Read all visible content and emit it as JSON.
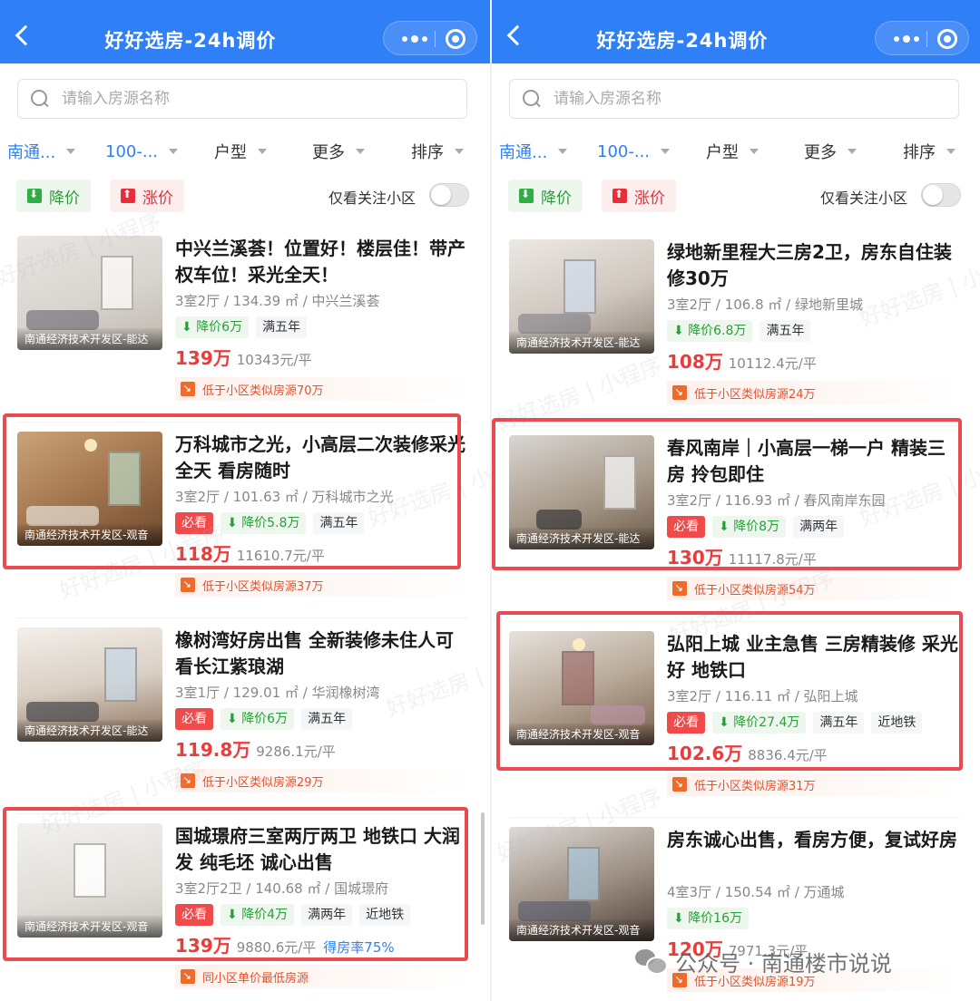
{
  "panels": [
    {
      "nav_title": "好好选房-24h调价",
      "search_placeholder": "请输入房源名称",
      "filters": [
        "南通...",
        "100-...",
        "户型",
        "更多",
        "排序"
      ],
      "price_down_chip": "降价",
      "price_up_chip": "涨价",
      "follow_label": "仅看关注小区",
      "cards": [
        {
          "title": "中兴兰溪荟！位置好！楼层佳！带产权车位！采光全天！",
          "meta": "3室2厅 / 134.39 ㎡ / 中兴兰溪荟",
          "image_caption": "南通经济技术开发区-能达",
          "must_tag": "",
          "drop_tag": "降价6万",
          "tags": [
            "满五年"
          ],
          "price": "139万",
          "unit_price": "10343元/平",
          "extra": "",
          "hint": "低于小区类似房源70万"
        },
        {
          "title": "万科城市之光，小高层二次装修采光全天 看房随时",
          "meta": "3室2厅 / 101.63 ㎡ / 万科城市之光",
          "image_caption": "南通经济技术开发区-观音",
          "must_tag": "必看",
          "drop_tag": "降价5.8万",
          "tags": [
            "满五年"
          ],
          "price": "118万",
          "unit_price": "11610.7元/平",
          "extra": "",
          "hint": "低于小区类似房源37万"
        },
        {
          "title": "橡树湾好房出售 全新装修未住人可看长江紫琅湖",
          "meta": "3室1厅 / 129.01 ㎡ / 华润橡树湾",
          "image_caption": "南通经济技术开发区-能达",
          "must_tag": "必看",
          "drop_tag": "降价6万",
          "tags": [
            "满五年"
          ],
          "price": "119.8万",
          "unit_price": "9286.1元/平",
          "extra": "",
          "hint": "低于小区类似房源29万"
        },
        {
          "title": "国城璟府三室两厅两卫 地铁口 大润发 纯毛坯 诚心出售",
          "meta": "3室2厅2卫 / 140.68 ㎡ / 国城璟府",
          "image_caption": "南通经济技术开发区-观音",
          "must_tag": "必看",
          "drop_tag": "降价4万",
          "tags": [
            "满两年",
            "近地铁"
          ],
          "price": "139万",
          "unit_price": "9880.6元/平",
          "extra": "得房率75%",
          "hint": "同小区单价最低房源"
        }
      ]
    },
    {
      "nav_title": "好好选房-24h调价",
      "search_placeholder": "请输入房源名称",
      "filters": [
        "南通...",
        "100-...",
        "户型",
        "更多",
        "排序"
      ],
      "price_down_chip": "降价",
      "price_up_chip": "涨价",
      "follow_label": "仅看关注小区",
      "cards": [
        {
          "title": "绿地新里程大三房2卫，房东自住装修30万",
          "meta": "3室2厅 / 106.8 ㎡ / 绿地新里城",
          "image_caption": "南通经济技术开发区-能达",
          "must_tag": "",
          "drop_tag": "降价6.8万",
          "tags": [
            "满五年"
          ],
          "price": "108万",
          "unit_price": "10112.4元/平",
          "extra": "",
          "hint": "低于小区类似房源24万"
        },
        {
          "title": "春风南岸｜小高层一梯一户 精装三房 拎包即住",
          "meta": "3室2厅 / 116.93 ㎡ / 春风南岸东园",
          "image_caption": "南通经济技术开发区-能达",
          "must_tag": "必看",
          "drop_tag": "降价8万",
          "tags": [
            "满两年"
          ],
          "price": "130万",
          "unit_price": "11117.8元/平",
          "extra": "",
          "hint": "低于小区类似房源54万"
        },
        {
          "title": "弘阳上城 业主急售 三房精装修 采光好 地铁口",
          "meta": "3室2厅 / 116.11 ㎡ / 弘阳上城",
          "image_caption": "南通经济技术开发区-观音",
          "must_tag": "必看",
          "drop_tag": "降价27.4万",
          "tags": [
            "满五年",
            "近地铁"
          ],
          "price": "102.6万",
          "unit_price": "8836.4元/平",
          "extra": "",
          "hint": "低于小区类似房源31万"
        },
        {
          "title": "房东诚心出售，看房方便，复试好房",
          "meta": "4室3厅 / 150.54 ㎡ / 万通城",
          "image_caption": "南通经济技术开发区-观音",
          "must_tag": "",
          "drop_tag": "降价16万",
          "tags": [],
          "price": "120万",
          "unit_price": "7971.3元/平",
          "extra": "",
          "hint": "低于小区类似房源19万"
        }
      ]
    }
  ],
  "watermark_text": "好好选房 | 小程序",
  "wechat_watermark": "公众号 · 南通楼市说说",
  "colors": {
    "nav_blue": "#2f7ff7",
    "price_red": "#ef3a3a",
    "highlight_red": "#e84b50",
    "drop_green": "#2a9c3a"
  }
}
